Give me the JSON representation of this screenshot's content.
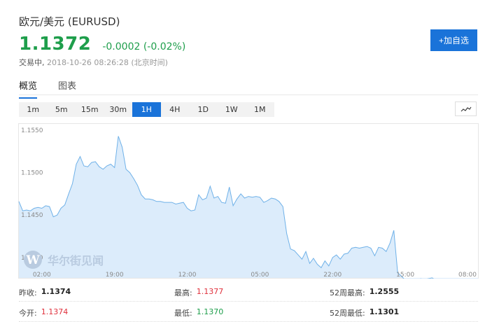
{
  "header": {
    "title": "欧元/美元 (EURUSD)",
    "price": "1.1372",
    "change": "-0.0002 (-0.02%)",
    "status_label": "交易中,",
    "timestamp": "2018-10-26 08:26:28 (北京时间)",
    "add_button": "+加自选"
  },
  "tabs": [
    {
      "label": "概览",
      "active": true
    },
    {
      "label": "图表",
      "active": false
    }
  ],
  "periods": [
    "1m",
    "5m",
    "15m",
    "30m",
    "1H",
    "4H",
    "1D",
    "1W",
    "1M"
  ],
  "active_period": "1H",
  "watermark": "华尔街见闻",
  "stats": {
    "prev_close_label": "昨收:",
    "prev_close": "1.1374",
    "high_label": "最高:",
    "high": "1.1377",
    "high52_label": "52周最高:",
    "high52": "1.2555",
    "open_label": "今开:",
    "open": "1.1374",
    "low_label": "最低:",
    "low": "1.1370",
    "low52_label": "52周最低:",
    "low52": "1.1301"
  },
  "colors": {
    "accent": "#1a73d9",
    "down": "#1e9e4b",
    "up": "#e0303c",
    "line": "#6fb1e8",
    "area": "#dcecfb"
  },
  "chart_data": {
    "type": "area",
    "ylim": [
      1.1385,
      1.1555
    ],
    "yticks": [
      "1.1550",
      "1.1500",
      "1.1450",
      "1.1400"
    ],
    "xticks": [
      {
        "x": 6,
        "label": "02:00"
      },
      {
        "x": 25,
        "label": "19:00"
      },
      {
        "x": 44,
        "label": "12:00"
      },
      {
        "x": 63,
        "label": "05:00"
      },
      {
        "x": 82,
        "label": "22:00"
      },
      {
        "x": 101,
        "label": "15:00"
      },
      {
        "x": 120,
        "label": "08:00"
      }
    ],
    "values": [
      1.1466,
      1.1455,
      1.1456,
      1.1455,
      1.1458,
      1.1459,
      1.1458,
      1.1461,
      1.146,
      1.1448,
      1.145,
      1.1458,
      1.1462,
      1.1475,
      1.1487,
      1.151,
      1.1519,
      1.1508,
      1.1507,
      1.1512,
      1.1513,
      1.1507,
      1.1504,
      1.1508,
      1.151,
      1.1506,
      1.1543,
      1.153,
      1.1504,
      1.15,
      1.1493,
      1.1485,
      1.1474,
      1.1469,
      1.1469,
      1.1468,
      1.1466,
      1.1466,
      1.1465,
      1.1465,
      1.1465,
      1.1463,
      1.1464,
      1.1465,
      1.1458,
      1.1455,
      1.1456,
      1.1474,
      1.1468,
      1.147,
      1.1484,
      1.147,
      1.1472,
      1.1465,
      1.1464,
      1.1483,
      1.1461,
      1.1469,
      1.1475,
      1.147,
      1.1472,
      1.1471,
      1.1472,
      1.1471,
      1.1465,
      1.1467,
      1.147,
      1.1469,
      1.1466,
      1.146,
      1.1428,
      1.141,
      1.1408,
      1.1403,
      1.1398,
      1.1407,
      1.1393,
      1.1399,
      1.1392,
      1.1388,
      1.1396,
      1.139,
      1.14,
      1.1403,
      1.1398,
      1.1404,
      1.1405,
      1.1411,
      1.1412,
      1.1411,
      1.1412,
      1.1413,
      1.1411,
      1.1402,
      1.1412,
      1.1411,
      1.1407,
      1.1417,
      1.1432,
      1.1382,
      1.1378,
      1.1373,
      1.1364,
      1.1366,
      1.1372,
      1.1375,
      1.1374,
      1.1375,
      1.1376,
      1.1373,
      1.1372,
      1.137,
      1.1368,
      1.1367,
      1.137,
      1.1372,
      1.1371,
      1.1373,
      1.1372,
      1.1371,
      1.1372
    ]
  }
}
